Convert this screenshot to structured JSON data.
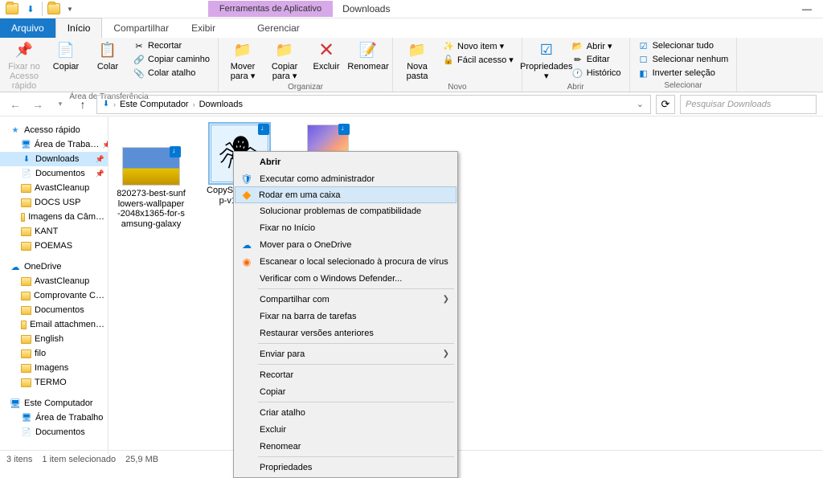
{
  "titlebar": {
    "tool_tab": "Ferramentas de Aplicativo",
    "title": "Downloads"
  },
  "tabs": {
    "file": "Arquivo",
    "home": "Início",
    "share": "Compartilhar",
    "view": "Exibir",
    "manage": "Gerenciar"
  },
  "ribbon": {
    "clipboard": {
      "pin": "Fixar no\nAcesso rápido",
      "copy": "Copiar",
      "paste": "Colar",
      "cut": "Recortar",
      "copy_path": "Copiar caminho",
      "paste_shortcut": "Colar atalho",
      "label": "Área de Transferência"
    },
    "organize": {
      "move_to": "Mover\npara ▾",
      "copy_to": "Copiar\npara ▾",
      "delete": "Excluir",
      "rename": "Renomear",
      "label": "Organizar"
    },
    "new": {
      "new_folder": "Nova\npasta",
      "new_item": "Novo item ▾",
      "easy_access": "Fácil acesso ▾",
      "label": "Novo"
    },
    "open": {
      "properties": "Propriedades\n▾",
      "open": "Abrir ▾",
      "edit": "Editar",
      "history": "Histórico",
      "label": "Abrir"
    },
    "select": {
      "select_all": "Selecionar tudo",
      "select_none": "Selecionar nenhum",
      "invert": "Inverter seleção",
      "label": "Selecionar"
    }
  },
  "breadcrumb": {
    "this_pc": "Este Computador",
    "downloads": "Downloads"
  },
  "search": {
    "placeholder": "Pesquisar Downloads"
  },
  "sidebar": {
    "quick_access": "Acesso rápido",
    "items_qa": [
      "Área de Traba…",
      "Downloads",
      "Documentos",
      "AvastCleanup",
      "DOCS USP",
      "Imagens da Câm…",
      "KANT",
      "POEMAS"
    ],
    "onedrive": "OneDrive",
    "items_od": [
      "AvastCleanup",
      "Comprovante C…",
      "Documentos",
      "Email attachmen…",
      "English",
      "filo",
      "Imagens",
      "TERMO"
    ],
    "this_pc": "Este Computador",
    "items_pc": [
      "Área de Trabalho",
      "Documentos"
    ]
  },
  "files": {
    "item1": "820273-best-sunf\nlowers-wallpaper\n-2048x1365-for-s\namsung-galaxy",
    "item2": "CopySpider-setu\np-v1.5.1…",
    "item3": ""
  },
  "context_menu": {
    "abrir": "Abrir",
    "admin": "Executar como administrador",
    "sandbox": "Rodar em uma caixa",
    "compat": "Solucionar problemas de compatibilidade",
    "pin_start": "Fixar no Início",
    "onedrive": "Mover para o OneDrive",
    "scan": "Escanear o local selecionado à procura de vírus",
    "defender": "Verificar com o Windows Defender...",
    "share": "Compartilhar com",
    "pin_taskbar": "Fixar na barra de tarefas",
    "restore": "Restaurar versões anteriores",
    "send_to": "Enviar para",
    "cut": "Recortar",
    "copy": "Copiar",
    "create_shortcut": "Criar atalho",
    "delete": "Excluir",
    "rename": "Renomear",
    "properties": "Propriedades"
  },
  "statusbar": {
    "count": "3 itens",
    "selected": "1 item selecionado",
    "size": "25,9 MB"
  }
}
